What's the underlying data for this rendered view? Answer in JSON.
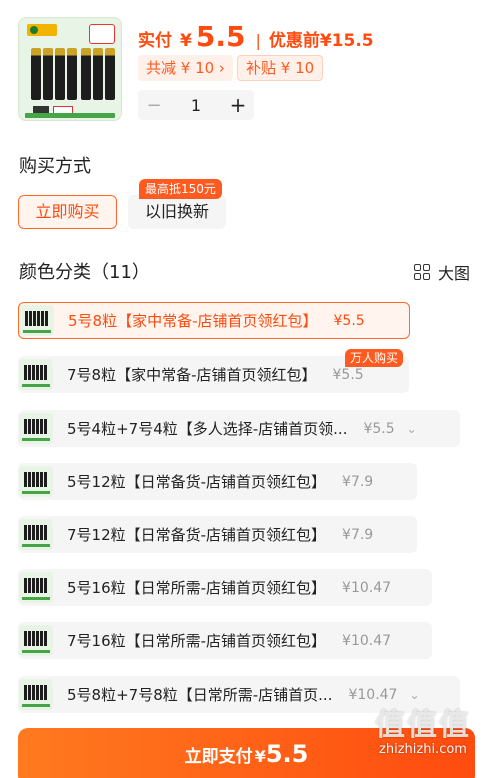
{
  "product": {
    "actual_label": "实付",
    "currency": "¥",
    "actual_price": "5.5",
    "separator": "|",
    "original_label": "优惠前",
    "original_price": "¥15.5",
    "discount_tag": "共减 ¥ 10 ›",
    "subsidy_tag": "补贴 ¥ 10"
  },
  "stepper": {
    "minus": "−",
    "quantity": "1",
    "plus": "+"
  },
  "buy_method": {
    "title": "购买方式",
    "buy_now": "立即购买",
    "trade_in": "以旧换新",
    "trade_in_tag": "最高抵150元"
  },
  "variants": {
    "title": "颜色分类（11）",
    "big_image_label": "大图",
    "hot_tag": "万人购买",
    "items": [
      {
        "name": "5号8粒【家中常备-店铺首页领红包】",
        "price": "¥5.5"
      },
      {
        "name": "7号8粒【家中常备-店铺首页领红包】",
        "price": "¥5.5"
      },
      {
        "name": "5号4粒+7号4粒【多人选择-店铺首页领...",
        "price": "¥5.5"
      },
      {
        "name": "5号12粒【日常备货-店铺首页领红包】",
        "price": "¥7.9"
      },
      {
        "name": "7号12粒【日常备货-店铺首页领红包】",
        "price": "¥7.9"
      },
      {
        "name": "5号16粒【日常所需-店铺首页领红包】",
        "price": "¥10.47"
      },
      {
        "name": "7号16粒【日常所需-店铺首页领红包】",
        "price": "¥10.47"
      },
      {
        "name": "5号8粒+7号8粒【日常所需-店铺首页...",
        "price": "¥10.47"
      }
    ]
  },
  "pay": {
    "label": "立即支付",
    "currency": "¥",
    "amount": "5.5"
  },
  "watermark": {
    "glyphs": "值值值",
    "url": "zhizhizhi.com"
  },
  "colors": {
    "accent": "#ff4b0f",
    "accent_light": "#fff4ee",
    "chip_bg": "#f5f5f5",
    "tag_bg": "#ff5a1f"
  }
}
